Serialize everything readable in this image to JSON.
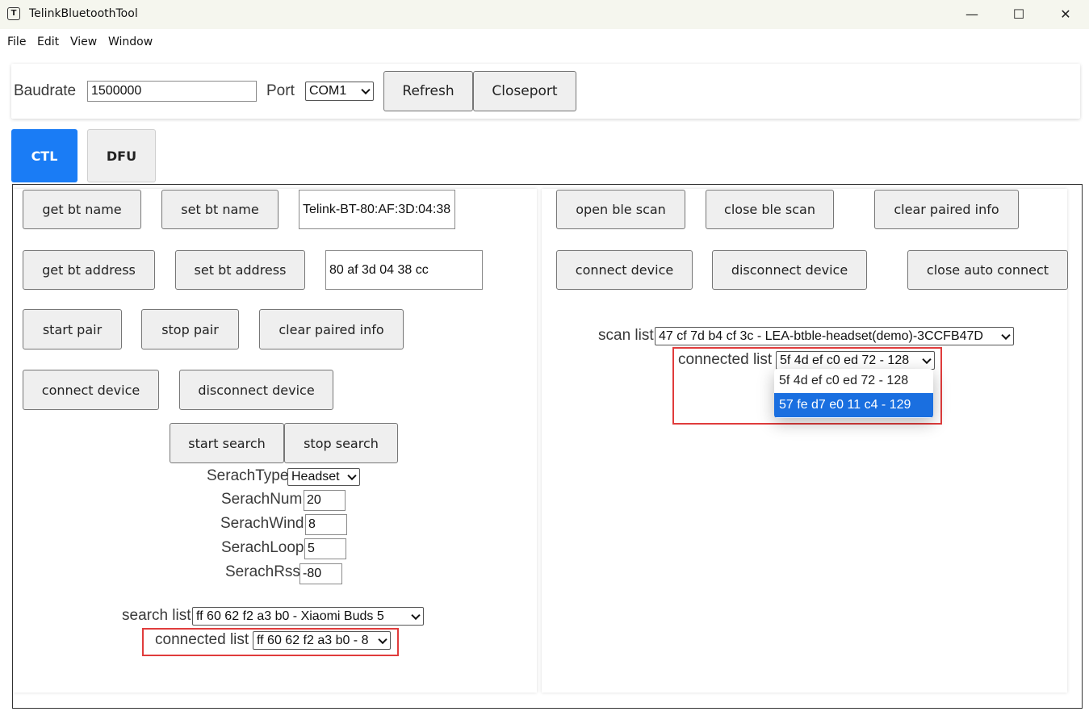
{
  "window": {
    "title": "TelinkBluetoothTool",
    "icon_glyph": "T",
    "controls": {
      "minimize": "—",
      "maximize": "☐",
      "close": "✕"
    }
  },
  "menu": [
    "File",
    "Edit",
    "View",
    "Window"
  ],
  "connection": {
    "baudrate_label": "Baudrate",
    "baudrate_value": "1500000",
    "port_label": "Port",
    "port_value": "COM1",
    "refresh_label": "Refresh",
    "closeport_label": "Closeport"
  },
  "tabs": [
    {
      "label": "CTL",
      "active": true
    },
    {
      "label": "DFU",
      "active": false
    }
  ],
  "left_panel": {
    "get_bt_name": "get bt name",
    "set_bt_name": "set bt name",
    "bt_name_value": "Telink-BT-80:AF:3D:04:38",
    "get_bt_address": "get bt address",
    "set_bt_address": "set bt address",
    "bt_address_value": "80 af 3d 04 38 cc",
    "start_pair": "start pair",
    "stop_pair": "stop pair",
    "clear_paired_info": "clear paired info",
    "connect_device": "connect device",
    "disconnect_device": "disconnect device",
    "start_search": "start search",
    "stop_search": "stop search",
    "search_type_label": "SerachType",
    "search_type_value": "Headset",
    "search_num_label": "SerachNum",
    "search_num_value": "20",
    "search_wind_label": "SerachWind",
    "search_wind_value": "8",
    "search_loop_label": "SerachLoop",
    "search_loop_value": "5",
    "search_rssi_label": "SerachRssi",
    "search_rssi_value": "-80",
    "search_list_label": "search list",
    "search_list_value": "ff 60 62 f2 a3 b0 - Xiaomi Buds 5",
    "connected_list_label": "connected list",
    "connected_list_value": "ff 60 62 f2 a3 b0 - 8"
  },
  "right_panel": {
    "open_ble_scan": "open ble scan",
    "close_ble_scan": "close ble scan",
    "clear_paired_info": "clear paired info",
    "connect_device": "connect device",
    "disconnect_device": "disconnect device",
    "close_auto_connect": "close auto connect",
    "scan_list_label": "scan list",
    "scan_list_value": "47 cf 7d b4 cf 3c - LEA-btble-headset(demo)-3CCFB47D",
    "connected_list_label": "connected list",
    "connected_list_value": "5f 4d ef c0 ed 72 - 128",
    "connected_list_options": [
      "5f 4d ef c0 ed 72 - 128",
      "57 fe d7 e0 11 c4 - 129"
    ],
    "highlighted_option_index": 1
  },
  "colors": {
    "active_tab": "#1a7cf5",
    "highlight_box": "#e03c3c",
    "dropdown_highlight": "#1a6fe0"
  }
}
